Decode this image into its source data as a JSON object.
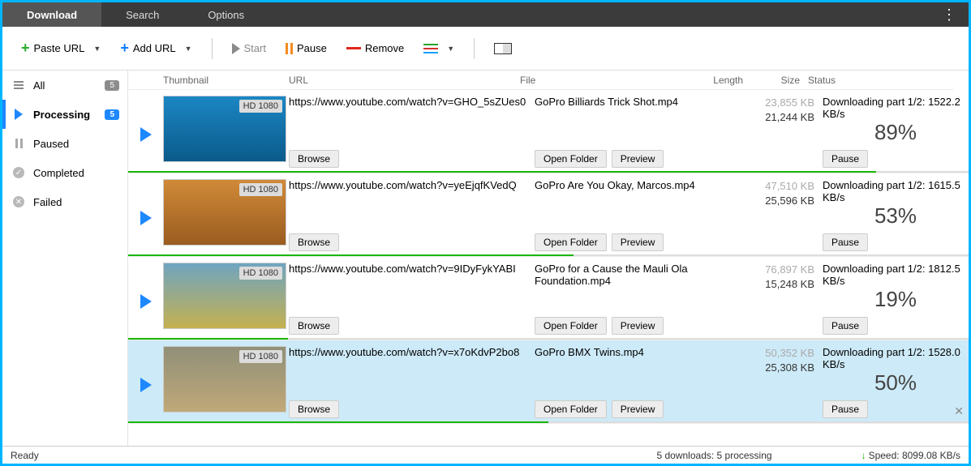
{
  "tabs": {
    "download": "Download",
    "search": "Search",
    "options": "Options"
  },
  "toolbar": {
    "paste": "Paste URL",
    "add": "Add URL",
    "start": "Start",
    "pause": "Pause",
    "remove": "Remove"
  },
  "sidebar": {
    "all": {
      "label": "All",
      "count": "5"
    },
    "processing": {
      "label": "Processing",
      "count": "5"
    },
    "paused": {
      "label": "Paused"
    },
    "completed": {
      "label": "Completed"
    },
    "failed": {
      "label": "Failed"
    }
  },
  "columns": {
    "thumb": "Thumbnail",
    "url": "URL",
    "file": "File",
    "length": "Length",
    "size": "Size",
    "status": "Status"
  },
  "buttons": {
    "browse": "Browse",
    "openFolder": "Open Folder",
    "preview": "Preview",
    "pause": "Pause"
  },
  "badge": "HD 1080",
  "rows": [
    {
      "url": "https://www.youtube.com/watch?v=GHO_5sZUes0",
      "file": "GoPro Billiards Trick Shot.mp4",
      "total": "23,855 KB",
      "done": "21,244 KB",
      "status": "Downloading part 1/2: 1522.2 KB/s",
      "pct": "89%",
      "bar": 89
    },
    {
      "url": "https://www.youtube.com/watch?v=yeEjqfKVedQ",
      "file": "GoPro Are You Okay, Marcos.mp4",
      "total": "47,510 KB",
      "done": "25,596 KB",
      "status": "Downloading part 1/2: 1615.5 KB/s",
      "pct": "53%",
      "bar": 53
    },
    {
      "url": "https://www.youtube.com/watch?v=9IDyFykYABI",
      "file": "GoPro for a Cause the Mauli Ola Foundation.mp4",
      "total": "76,897 KB",
      "done": "15,248 KB",
      "status": "Downloading part 1/2: 1812.5 KB/s",
      "pct": "19%",
      "bar": 19
    },
    {
      "url": "https://www.youtube.com/watch?v=x7oKdvP2bo8",
      "file": "GoPro BMX Twins.mp4",
      "total": "50,352 KB",
      "done": "25,308 KB",
      "status": "Downloading part 1/2: 1528.0 KB/s",
      "pct": "50%",
      "bar": 50
    }
  ],
  "thumbs": [
    "linear-gradient(#1b87c4,#0b5a8a)",
    "linear-gradient(#d08a38,#9a5c20)",
    "linear-gradient(#6fa5c0,#c4b050)",
    "linear-gradient(#909078,#c0a878)"
  ],
  "status": {
    "ready": "Ready",
    "middle": "5 downloads: 5 processing",
    "speed": "Speed: 8099.08 KB/s"
  }
}
